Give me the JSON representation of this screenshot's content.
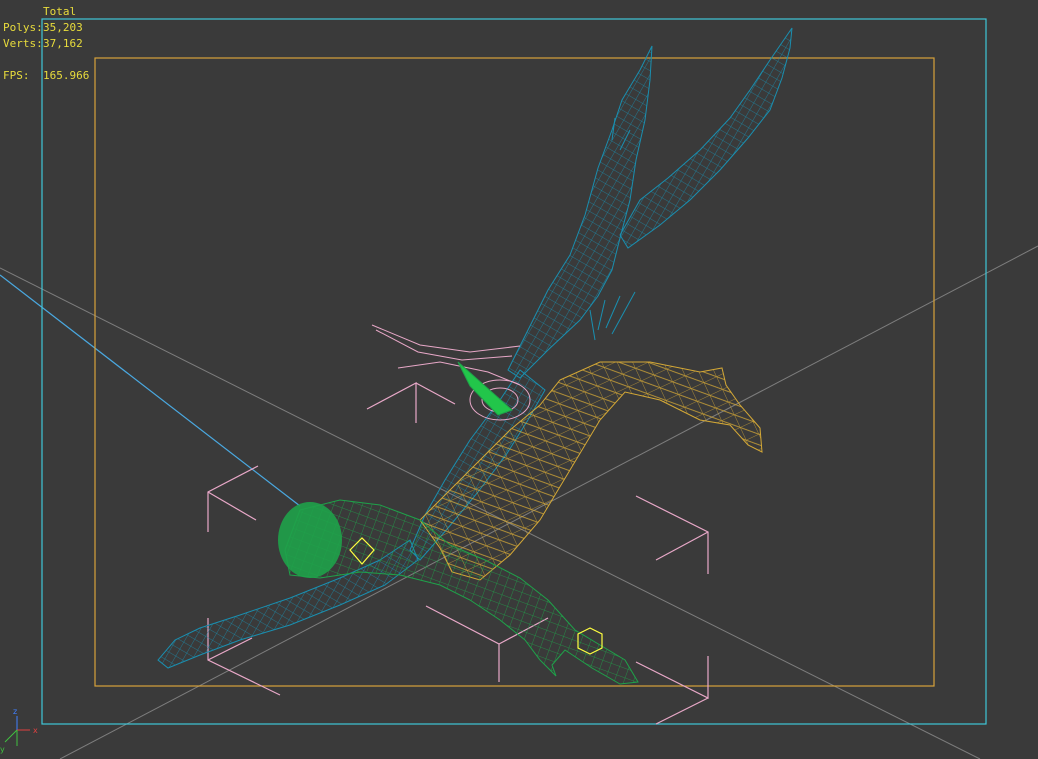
{
  "stats": {
    "header": "Total",
    "polys_label": "Polys:",
    "polys_value": "35,203",
    "verts_label": "Verts:",
    "verts_value": "37,162",
    "fps_label": "FPS:",
    "fps_value": "165.966"
  },
  "colors": {
    "background": "#3a3a3a",
    "safe_frame_outer": "#3fc6d8",
    "safe_frame_inner": "#d6a23a",
    "stats_text": "#e8dc3c",
    "wire_blue": "#1a8fb0",
    "wire_yellow": "#d4a836",
    "wire_green": "#1fa24a",
    "wire_pink": "#e8a8c8",
    "grid_line": "#9a9a9a"
  },
  "axis_gizmo": {
    "x_label": "x",
    "y_label": "y",
    "z_label": "z"
  }
}
